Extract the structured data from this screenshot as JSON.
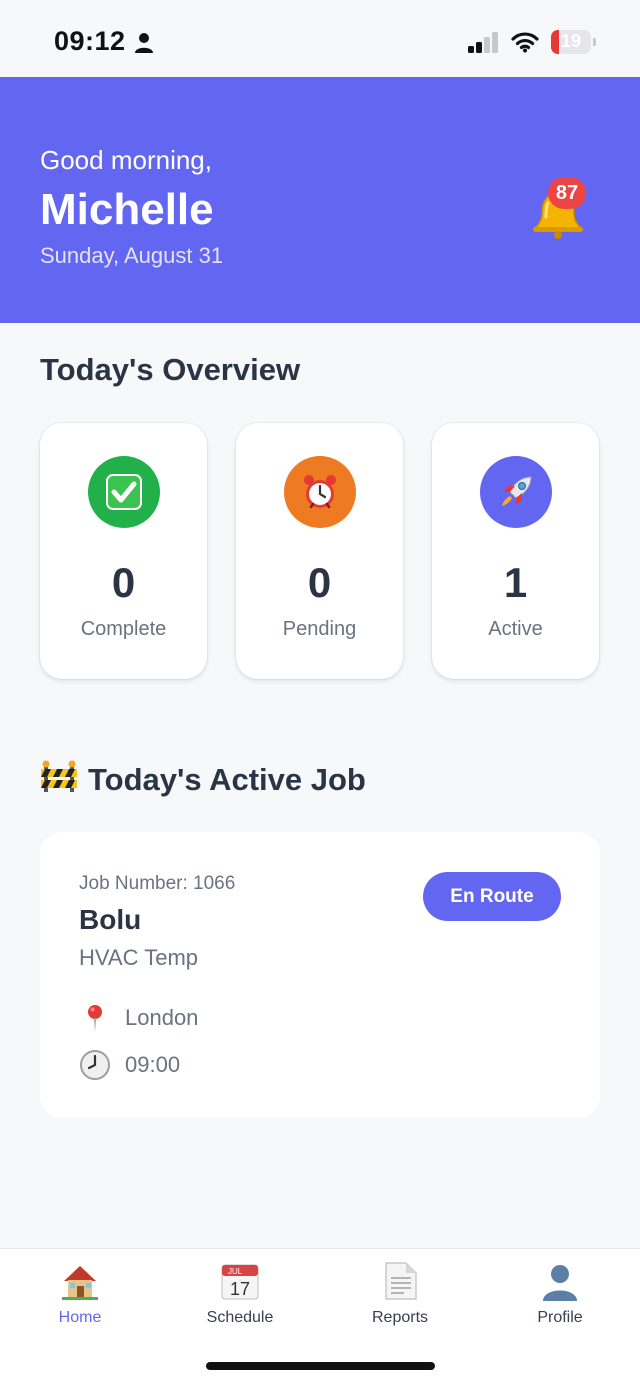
{
  "status_bar": {
    "time": "09:12",
    "battery_level": "19",
    "battery_fraction": 0.19,
    "icons": [
      "person-icon",
      "cellular-signal-icon",
      "wifi-icon",
      "battery-icon"
    ]
  },
  "header": {
    "greeting": "Good morning,",
    "name": "Michelle",
    "date": "Sunday, August 31",
    "notification_count": "87",
    "icon": "bell-icon"
  },
  "overview": {
    "title": "Today's Overview",
    "cards": [
      {
        "value": "0",
        "label": "Complete",
        "icon": "check-mark-icon",
        "color": "#22b04b"
      },
      {
        "value": "0",
        "label": "Pending",
        "icon": "alarm-clock-icon",
        "color": "#ee7b22"
      },
      {
        "value": "1",
        "label": "Active",
        "icon": "rocket-icon",
        "color": "#6366f1"
      }
    ]
  },
  "active_job": {
    "title": "Today's Active Job",
    "icon": "construction-barrier-icon",
    "job_number": "Job Number: 1066",
    "client": "Bolu",
    "type": "HVAC Temp",
    "status": "En Route",
    "location": "London",
    "time": "09:00"
  },
  "tab_bar": {
    "tabs": [
      {
        "label": "Home",
        "icon": "house-icon",
        "active": true
      },
      {
        "label": "Schedule",
        "icon": "calendar-icon",
        "active": false,
        "calendar_month": "JUL",
        "calendar_day": "17"
      },
      {
        "label": "Reports",
        "icon": "document-icon",
        "active": false
      },
      {
        "label": "Profile",
        "icon": "person-silhouette-icon",
        "active": false
      }
    ]
  },
  "colors": {
    "primary": "#6366f1",
    "background": "#f7f8fa",
    "text_dark": "#2b3445",
    "text_muted": "#6b7280",
    "badge": "#ef4444"
  }
}
